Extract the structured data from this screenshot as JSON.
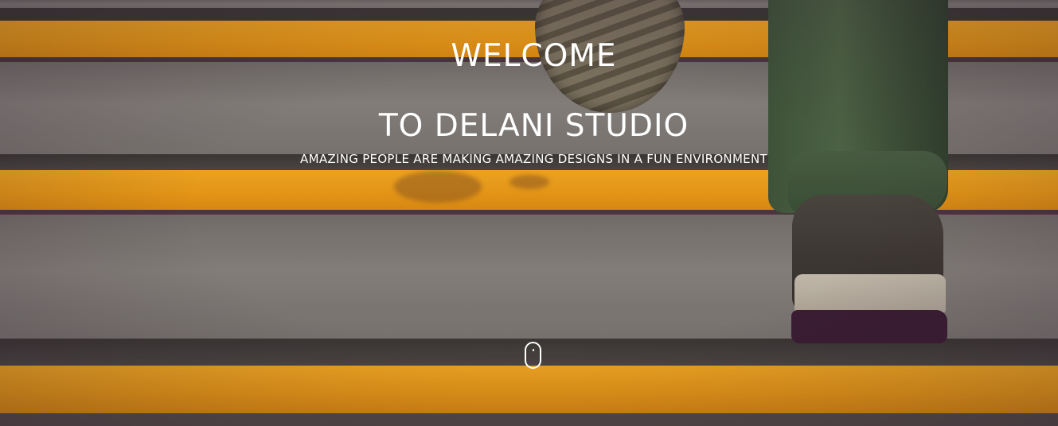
{
  "hero": {
    "heading_line_1": "WELCOME",
    "heading_line_2": "TO DELANI STUDIO",
    "tagline": "AMAZING PEOPLE ARE MAKING AMAZING DESIGNS IN A FUN ENVIRONMENT",
    "scroll_indicator_icon": "mouse-scroll-icon"
  },
  "colors": {
    "text": "#ffffff",
    "stripe_yellow": "#f7a414",
    "concrete_gray": "#7d7c75"
  }
}
